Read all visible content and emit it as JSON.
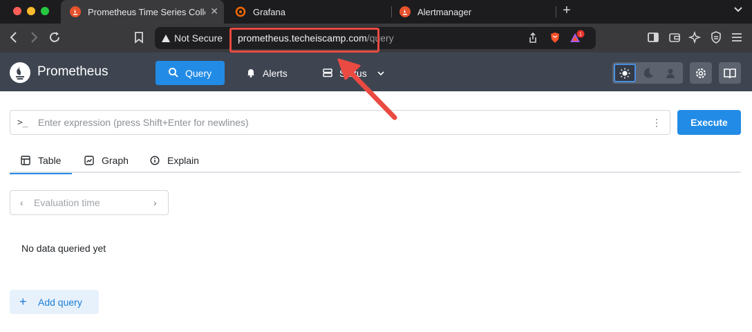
{
  "browser": {
    "tabs": [
      {
        "title": "Prometheus Time Series Colle",
        "active": true,
        "favicon": "prometheus-icon"
      },
      {
        "title": "Grafana",
        "active": false,
        "favicon": "grafana-icon"
      },
      {
        "title": "Alertmanager",
        "active": false,
        "favicon": "prometheus-icon"
      }
    ],
    "close_glyph": "✕",
    "new_tab_glyph": "+",
    "tab_menu_glyph": "⌄",
    "toolbar": {
      "security_label": "Not Secure",
      "url_host": "prometheus.techeiscamp.com",
      "url_path": "/query",
      "shields_badge": "1"
    }
  },
  "app": {
    "brand": "Prometheus",
    "nav": [
      {
        "label": "Query",
        "icon": "search-icon",
        "active": true
      },
      {
        "label": "Alerts",
        "icon": "bell-icon",
        "active": false
      },
      {
        "label": "Status",
        "icon": "server-icon",
        "active": false,
        "dropdown": true
      }
    ],
    "theme_modes": [
      "sun-icon",
      "moon-icon",
      "user-icon"
    ],
    "accent": "#228be6"
  },
  "query": {
    "prompt_glyph": ">_",
    "placeholder": "Enter expression (press Shift+Enter for newlines)",
    "menu_glyph": "⋮",
    "execute_label": "Execute",
    "tabs": [
      {
        "label": "Table",
        "icon": "table-icon",
        "active": true
      },
      {
        "label": "Graph",
        "icon": "graph-icon",
        "active": false
      },
      {
        "label": "Explain",
        "icon": "info-icon",
        "active": false
      }
    ],
    "eval_prev_glyph": "‹",
    "eval_next_glyph": "›",
    "eval_placeholder": "Evaluation time",
    "empty_message": "No data queried yet",
    "add_query_glyph": "+",
    "add_query_label": "Add query"
  }
}
